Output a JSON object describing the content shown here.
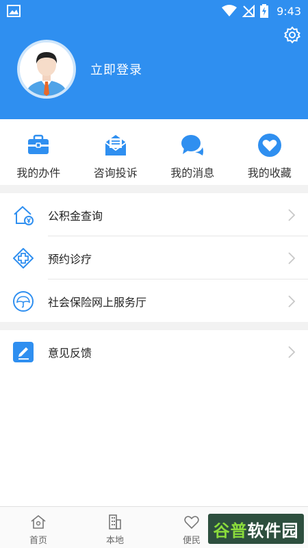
{
  "status_bar": {
    "time": "9:43"
  },
  "profile": {
    "login_label": "立即登录"
  },
  "quick_actions": [
    {
      "label": "我的办件",
      "icon": "briefcase-icon"
    },
    {
      "label": "咨询投诉",
      "icon": "mail-icon"
    },
    {
      "label": "我的消息",
      "icon": "chat-bubbles-icon"
    },
    {
      "label": "我的收藏",
      "icon": "heart-icon"
    }
  ],
  "menu_group_1": [
    {
      "label": "公积金查询",
      "icon": "house-fund-icon"
    },
    {
      "label": "预约诊疗",
      "icon": "medical-cross-icon"
    },
    {
      "label": "社会保险网上服务厅",
      "icon": "umbrella-icon"
    }
  ],
  "menu_group_2": [
    {
      "label": "意见反馈",
      "icon": "edit-icon"
    }
  ],
  "bottom_nav": [
    {
      "label": "首页",
      "icon": "home-icon"
    },
    {
      "label": "本地",
      "icon": "building-icon"
    },
    {
      "label": "便民",
      "icon": "heart-outline-icon"
    },
    {
      "label": "",
      "icon": "user-icon"
    }
  ],
  "watermark": {
    "text_a": "谷普",
    "text_b": "软件园"
  },
  "colors": {
    "primary": "#2f8ff0",
    "background": "#ffffff",
    "separator": "#f2f2f2"
  }
}
